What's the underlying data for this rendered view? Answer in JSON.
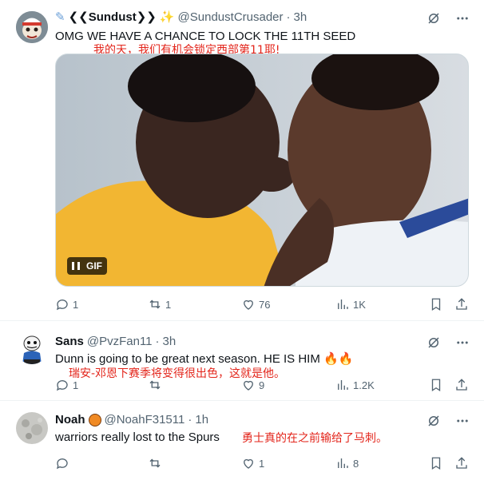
{
  "colors": {
    "text": "#0f1419",
    "secondary": "#536471",
    "divider": "#eff3f4",
    "translation": "#e3251b",
    "gif_badge_bg": "#000000"
  },
  "tweets": [
    {
      "name": "❮❮Sundust❯❯",
      "handle": "@SundustCrusader",
      "separator": "·",
      "time": "3h",
      "text": "OMG WE HAVE A CHANCE TO LOCK THE 11TH SEED",
      "translation": "我的天，我们有机会锁定西部第11耶!",
      "media": {
        "type": "gif",
        "badge": "GIF"
      },
      "replies": "1",
      "reposts": "1",
      "likes": "76",
      "views": "1K"
    },
    {
      "name": "Sans",
      "handle": "@PvzFan11",
      "separator": "·",
      "time": "3h",
      "text": "Dunn is going to be great next season. HE IS HIM 🔥🔥",
      "translation": "瑞安-邓恩下赛季将变得很出色，这就是他。",
      "replies": "1",
      "reposts": "",
      "likes": "9",
      "views": "1.2K"
    },
    {
      "name": "Noah",
      "handle": "@NoahF31511",
      "separator": "·",
      "time": "1h",
      "text": "warriors really lost to the Spurs",
      "translation": "勇士真的在之前输给了马刺。",
      "replies": "",
      "reposts": "",
      "likes": "1",
      "views": "8"
    }
  ]
}
